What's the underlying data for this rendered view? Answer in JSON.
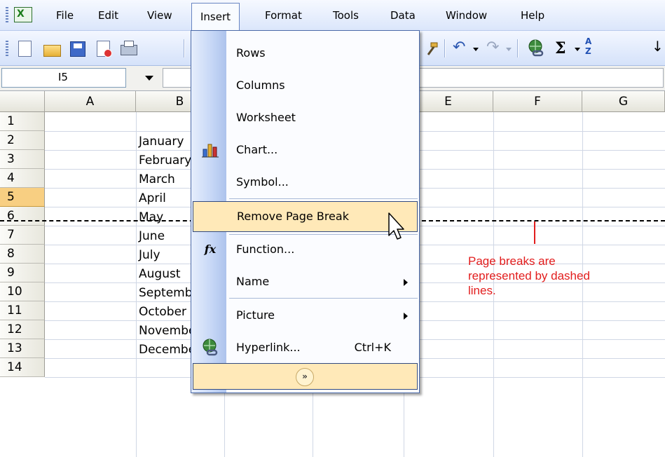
{
  "menubar": {
    "items": [
      "File",
      "Edit",
      "View",
      "Insert",
      "Format",
      "Tools",
      "Data",
      "Window",
      "Help"
    ],
    "active": "Insert"
  },
  "toolbar": {
    "icons": [
      "new-icon",
      "open-icon",
      "save-icon",
      "permission-icon",
      "print-icon",
      "format-painter-icon",
      "undo-icon",
      "redo-icon",
      "hyperlink-icon",
      "autosum-icon",
      "sort-ascending-icon"
    ],
    "sigma": "Σ",
    "sort": "A Z"
  },
  "namebox": {
    "value": "I5"
  },
  "columns": [
    "A",
    "B",
    "E",
    "F",
    "G"
  ],
  "rows": [
    "1",
    "2",
    "3",
    "4",
    "5",
    "6",
    "7",
    "8",
    "9",
    "10",
    "11",
    "12",
    "13",
    "14"
  ],
  "selected_row": "5",
  "column_b_values": [
    "",
    "January",
    "February",
    "March",
    "April",
    "May",
    "June",
    "July",
    "August",
    "September",
    "October",
    "November",
    "December",
    ""
  ],
  "insert_menu": {
    "items": [
      {
        "label": "Rows"
      },
      {
        "label": "Columns"
      },
      {
        "label": "Worksheet"
      },
      {
        "label": "Chart..."
      },
      {
        "label": "Symbol..."
      },
      {
        "label": "Remove Page Break"
      },
      {
        "label": "Function..."
      },
      {
        "label": "Name"
      },
      {
        "label": "Picture"
      },
      {
        "label": "Hyperlink...",
        "shortcut": "Ctrl+K"
      }
    ],
    "highlighted": "Remove Page Break",
    "expand_glyph": "»"
  },
  "annotation": {
    "text": "Page breaks are\nrepresented by dashed\nlines.",
    "color": "#e21d1d"
  },
  "colors": {
    "menu_highlight": "#ffe9b8",
    "selected_row_header": "#f8cf82"
  }
}
